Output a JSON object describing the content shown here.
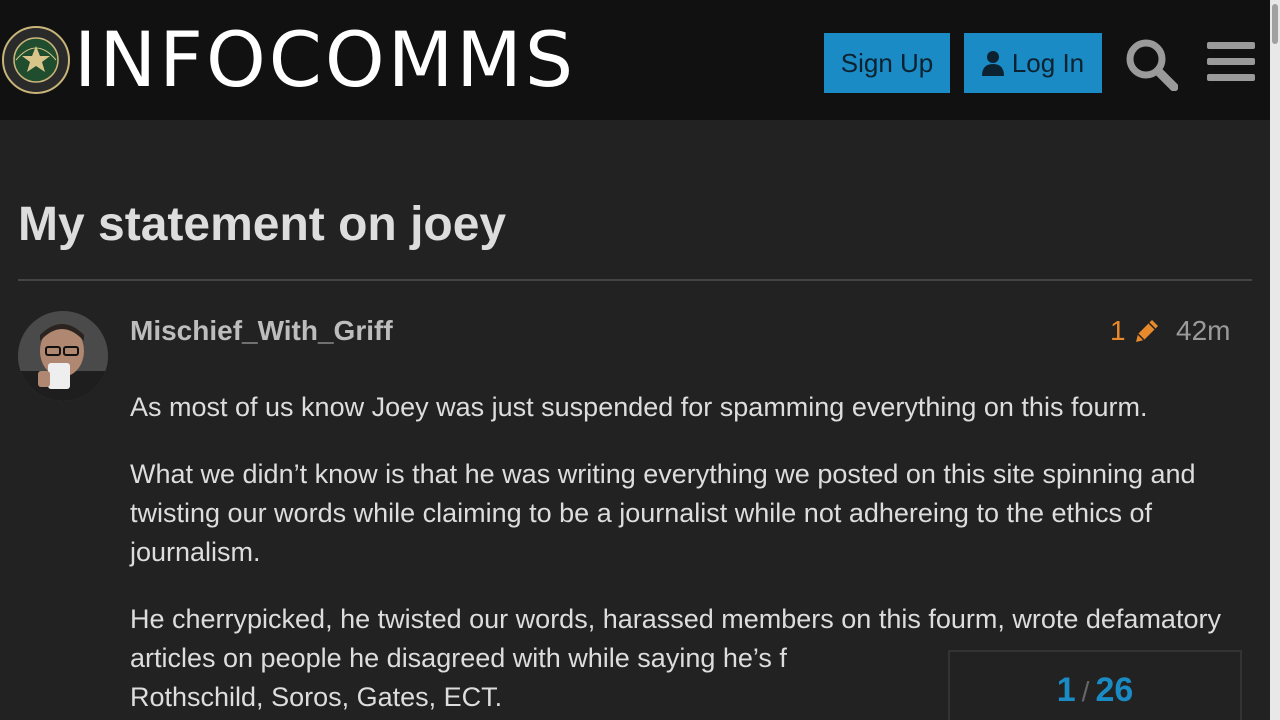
{
  "header": {
    "brand": "INFOCOMMS",
    "logo_seal_text": "INFOWARS ARMY",
    "signup_label": "Sign Up",
    "login_label": "Log In",
    "search_icon": "search-icon",
    "menu_icon": "hamburger-menu-icon",
    "accent_color": "#1a8bc4"
  },
  "topic": {
    "title": "My statement on joey"
  },
  "post": {
    "username": "Mischief_With_Griff",
    "edit_count": "1",
    "edit_icon": "pencil-icon",
    "age": "42m",
    "paragraphs": [
      "As most of us know Joey was just suspended for spamming everything on this fourm.",
      "What we didn’t know is that he was writing everything we posted on this site spinning and twisting our words while claiming to be a journalist while not adhereing to the ethics of journalism.",
      "He cherrypicked, he twisted our words, harassed members on this fourm, wrote defamatory articles on people he disagreed with while saying he’s f",
      "Rothschild, Soros, Gates, ECT."
    ]
  },
  "timeline": {
    "current": "1",
    "separator": "/",
    "total": "26"
  }
}
